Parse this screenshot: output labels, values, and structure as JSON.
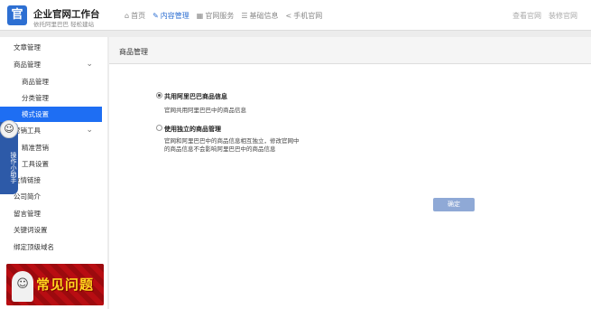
{
  "brand": {
    "logo_char": "官",
    "title": "企业官网工作台",
    "subtitle": "依托阿里巴巴 轻松建站"
  },
  "nav": [
    {
      "label": "首页",
      "icon": "home-icon",
      "glyph": "⌂"
    },
    {
      "label": "内容管理",
      "icon": "edit-icon",
      "glyph": "✎"
    },
    {
      "label": "官网服务",
      "icon": "service-icon",
      "glyph": "▦"
    },
    {
      "label": "基础信息",
      "icon": "list-icon",
      "glyph": "☰"
    },
    {
      "label": "手机官网",
      "icon": "share-icon",
      "glyph": "<"
    }
  ],
  "header_links": [
    "查看官网",
    "装修官网"
  ],
  "sidebar": {
    "items": [
      {
        "label": "文章管理"
      },
      {
        "label": "商品管理"
      },
      {
        "label": "商品管理"
      },
      {
        "label": "分类管理"
      },
      {
        "label": "模式设置"
      },
      {
        "label": "营销工具"
      },
      {
        "label": "精准营销"
      },
      {
        "label": "工具设置"
      },
      {
        "label": "友情链接"
      },
      {
        "label": "公司简介"
      },
      {
        "label": "留言管理"
      },
      {
        "label": "关键词设置"
      },
      {
        "label": "绑定顶级域名"
      }
    ],
    "helper_label": "操作小助手",
    "faq_label": "常见问题"
  },
  "panel": {
    "title": "商品管理",
    "options": [
      {
        "label": "共用阿里巴巴商品信息",
        "desc": [
          "官网共用阿里巴巴中的商品信息"
        ]
      },
      {
        "label": "使用独立的商品管理",
        "desc": [
          "官网和阿里巴巴中的商品信息相互独立，修改官网中",
          "的商品信息不会影响阿里巴巴中的商品信息"
        ]
      }
    ],
    "confirm_label": "确定"
  },
  "colors": {
    "accent": "#1e6ef3",
    "nav_active": "#2d6fd2",
    "button": "#8fa9d6"
  }
}
